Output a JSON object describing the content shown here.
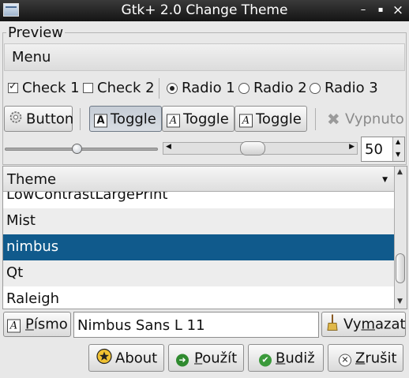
{
  "window": {
    "title": "Gtk+ 2.0 Change Theme",
    "minimize": "–",
    "maximize": "▪",
    "close": "×"
  },
  "preview": {
    "label": "Preview",
    "menu_label": "Menu",
    "checks": [
      {
        "label": "Check 1",
        "checked": true
      },
      {
        "label": "Check 2",
        "checked": false
      }
    ],
    "radios": [
      {
        "label": "Radio 1",
        "selected": true
      },
      {
        "label": "Radio 2",
        "selected": false
      },
      {
        "label": "Radio 3",
        "selected": false
      }
    ],
    "buttons": {
      "button": "Button",
      "toggles": [
        "Toggle",
        "Toggle",
        "Toggle"
      ],
      "disabled": "Vypnuto"
    },
    "slider_level": 0.47,
    "scroll_level": 0.45,
    "spin_value": "50"
  },
  "theme_list": {
    "header": "Theme",
    "items": [
      "LowContrastLargePrint",
      "Mist",
      "nimbus",
      "Qt",
      "Raleigh"
    ],
    "selected": "nimbus"
  },
  "font_row": {
    "font_button": "Písmo",
    "font_value": "Nimbus Sans L 11",
    "clear_button": "Vymazat"
  },
  "actions": {
    "about": "About",
    "apply": "Použít",
    "ok": "Budiž",
    "cancel": "Zrušit"
  }
}
